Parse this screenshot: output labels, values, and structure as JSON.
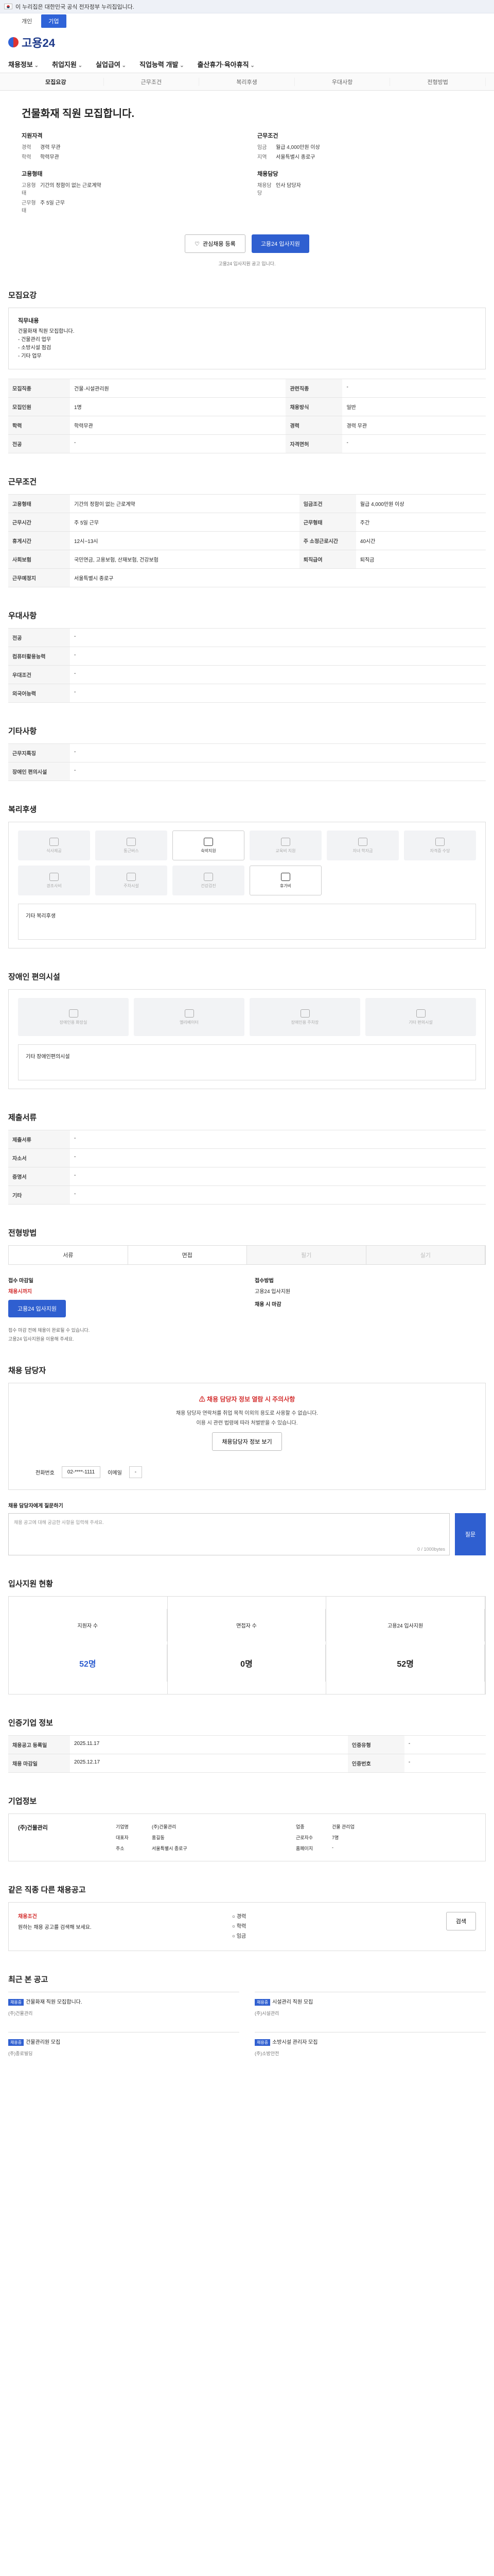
{
  "gov_banner": "이 누리집은 대한민국 공식 전자정부 누리집입니다.",
  "tabs": [
    "개인",
    "기업"
  ],
  "logo": "고용24",
  "gnb": [
    "채용정보",
    "취업지원",
    "실업급여",
    "직업능력 개발",
    "출산휴가·육아휴직"
  ],
  "subnav": [
    "모집요강",
    "근무조건",
    "복리후생",
    "우대사항",
    "전형방법"
  ],
  "title": "건물화재 직원 모집합니다.",
  "summary": {
    "left": [
      {
        "h": "지원자격",
        "rows": [
          [
            "경력",
            "경력 무관"
          ],
          [
            "학력",
            "학력무관"
          ]
        ]
      },
      {
        "h": "고용형태",
        "rows": [
          [
            "고용형태",
            "기간의 정함이 없는 근로계약"
          ],
          [
            "근무형태",
            "주 5일 근무"
          ]
        ]
      }
    ],
    "right": [
      {
        "h": "근무조건",
        "rows": [
          [
            "임금",
            "월급 4,000만원 이상"
          ],
          [
            "지역",
            "서울특별시 종로구"
          ]
        ]
      },
      {
        "h": "채용담당",
        "rows": [
          [
            "채용담당",
            "인사 담당자"
          ]
        ]
      }
    ]
  },
  "actions": {
    "interest": "관심채용 등록",
    "apply": "고용24 입사지원"
  },
  "action_note": "고용24 입사지원 공고 입니다.",
  "sec_recruit": "모집요강",
  "recruit_box": {
    "h": "직무내용",
    "lines": [
      "건물화재 직원 모집합니다.",
      "- 건물관리 업무",
      "- 소방시설 점검",
      "- 기타 업무"
    ]
  },
  "recruit_table": [
    [
      "모집직종",
      "건물·시설관리원",
      "관련직종",
      "-"
    ],
    [
      "모집인원",
      "1명",
      "채용방식",
      "일반"
    ],
    [
      "학력",
      "학력무관",
      "경력",
      "경력 무관"
    ],
    [
      "전공",
      "-",
      "자격면허",
      "-"
    ]
  ],
  "sec_work": "근무조건",
  "work_table": [
    [
      "고용형태",
      "기간의 정함이 없는 근로계약",
      "임금조건",
      "월급 4,000만원 이상"
    ],
    [
      "근무시간",
      "주 5일 근무",
      "근무형태",
      "주간"
    ],
    [
      "휴게시간",
      "12시~13시",
      "주 소정근로시간",
      "40시간"
    ],
    [
      "사회보험",
      "국민연금, 고용보험, 산재보험, 건강보험",
      "퇴직급여",
      "퇴직금"
    ],
    [
      "근무예정지",
      "서울특별시 종로구",
      "",
      ""
    ]
  ],
  "sec_prefer": "우대사항",
  "prefer_table": [
    [
      "전공",
      "-"
    ],
    [
      "컴퓨터활용능력",
      "-"
    ],
    [
      "우대조건",
      "-"
    ],
    [
      "외국어능력",
      "-"
    ]
  ],
  "sec_etc": "기타사항",
  "etc_table": [
    [
      "근무지특징",
      "-"
    ],
    [
      "장애인 편의시설",
      "-"
    ]
  ],
  "sec_welfare": "복리후생",
  "welfare_icons": [
    "식사제공",
    "통근버스",
    "숙박지원",
    "교육비 지원",
    "자녀 학자금",
    "자격증 수당",
    "경조사비",
    "주차시설",
    "건강검진",
    "휴가비"
  ],
  "welfare_empty": "기타 복리후생",
  "sec_disabled": "장애인 편의시설",
  "disabled_icons": [
    "장애인용 화장실",
    "엘리베이터",
    "장애인용 주차장",
    "기타 편의시설"
  ],
  "disabled_empty": "기타 장애인편의시설",
  "sec_docs": "제출서류",
  "docs_table": [
    [
      "제출서류",
      "-"
    ],
    [
      "자소서",
      "-"
    ],
    [
      "증명서",
      "-"
    ],
    [
      "기타",
      "-"
    ]
  ],
  "sec_method": "전형방법",
  "methods": [
    "서류",
    "면접",
    "필기",
    "실기"
  ],
  "receipt": {
    "deadline_h": "접수 마감일",
    "deadline": "채용시까지",
    "method_h": "접수방법",
    "method": "고용24 입사지원",
    "fee_h": "채용 시 마감",
    "btn": "고용24 입사지원"
  },
  "method_notes": [
    "접수 마감 전에 채용이 완료될 수 있습니다.",
    "고용24 입사지원을 이용해 주세요."
  ],
  "sec_contact": "채용 담당자",
  "alert": {
    "t1": "채용 담당자 정보 열람 시 주의사항",
    "t2": "채용 담당자 연락처를 취업 목적 이외의 용도로 사용할 수 없습니다.",
    "t3": "이용 시 관련 법령에 따라 처벌받을 수 있습니다.",
    "btn": "채용담당자 정보 보기"
  },
  "contact": {
    "phone_label": "전화번호",
    "phone": "02-****-1111",
    "email_label": "이메일",
    "email": "-"
  },
  "question_label": "채용 담당자에게 질문하기",
  "question_placeholder": "채용 공고에 대해 궁금한 사항을 입력해 주세요.",
  "question_count": "0 / 1000bytes",
  "question_send": "질문",
  "sec_stat": "입사지원 현황",
  "stats": [
    [
      "지원자 수",
      "52명"
    ],
    [
      "면접자 수",
      "0명"
    ],
    [
      "고용24 입사지원",
      "52명"
    ]
  ],
  "sec_info": "인증기업 정보",
  "info_table": [
    [
      "채용공고 등록일",
      "2025.11.17",
      "인증유형",
      "-"
    ],
    [
      "채용 마감일",
      "2025.12.17",
      "인증번호",
      "-"
    ]
  ],
  "sec_company": "기업정보",
  "company": {
    "name": "(주)건물관리",
    "rows": [
      [
        "기업명",
        "(주)건물관리",
        "업종",
        "건물 관리업"
      ],
      [
        "대표자",
        "홍길동",
        "근로자수",
        "7명"
      ],
      [
        "주소",
        "서울특별시 종로구",
        "홈페이지",
        "-"
      ]
    ]
  },
  "sec_related": "같은 직종 다른 채용공고",
  "related_box": {
    "h": "채용조건",
    "t": "원하는 채용 공고를 검색해 보세요.",
    "opts": [
      "경력",
      "학력",
      "임금"
    ],
    "btn": "검색"
  },
  "sec_recent": "최근 본 공고",
  "related": [
    {
      "badge": "채용중",
      "title": "건물화재 직원 모집합니다.",
      "meta": "(주)건물관리"
    },
    {
      "badge": "채용중",
      "title": "시설관리 직원 모집",
      "meta": "(주)시설관리"
    },
    {
      "badge": "채용중",
      "title": "건물관리원 모집",
      "meta": "(주)종로빌딩"
    },
    {
      "badge": "채용중",
      "title": "소방시설 관리자 모집",
      "meta": "(주)소방안전"
    }
  ]
}
